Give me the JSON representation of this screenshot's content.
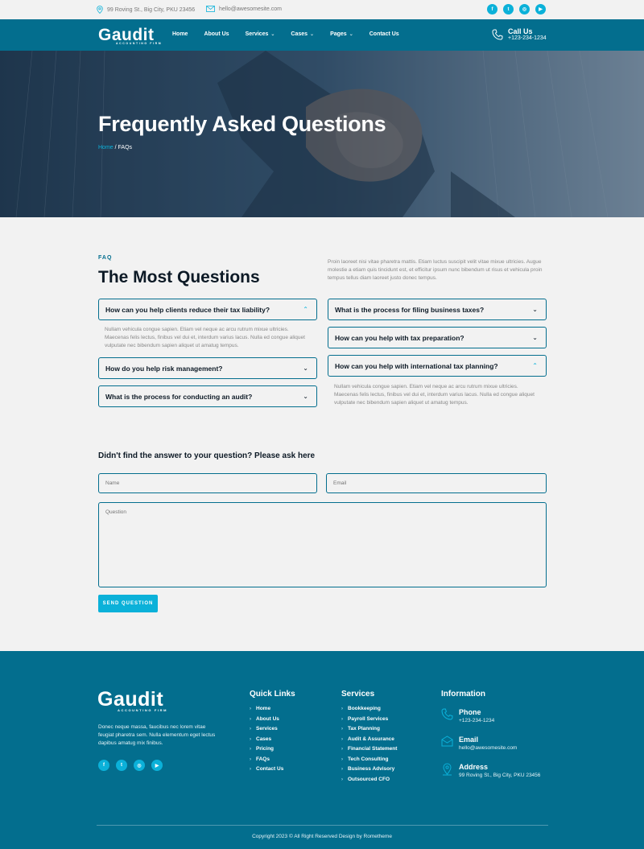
{
  "topbar": {
    "address": "99 Roving St., Big City, PKU 23456",
    "email": "hello@awesomesite.com",
    "socials": [
      "facebook-icon",
      "twitter-icon",
      "instagram-icon",
      "youtube-icon"
    ]
  },
  "brand": {
    "name": "Gaudit",
    "tagline": "Accounting Firm"
  },
  "nav": {
    "items": [
      {
        "label": "Home",
        "dropdown": false
      },
      {
        "label": "About Us",
        "dropdown": false
      },
      {
        "label": "Services",
        "dropdown": true
      },
      {
        "label": "Cases",
        "dropdown": true
      },
      {
        "label": "Pages",
        "dropdown": true
      },
      {
        "label": "Contact Us",
        "dropdown": false
      }
    ],
    "call_title": "Call Us",
    "call_number": "+123-234-1234"
  },
  "hero": {
    "title": "Frequently Asked Questions",
    "breadcrumb_home": "Home",
    "breadcrumb_sep": " / ",
    "breadcrumb_current": "FAQs"
  },
  "faq": {
    "eyebrow": "FAQ",
    "title": "The Most Questions",
    "intro": "Proin laoreet nisi vitae pharetra mattis. Etiam luctus suscipit velit vitae mixue ultricies. Augue molestie a etiam quis tincidunt est, et efficitur ipsum nunc bibendum ut risus et vehicula proin tempus tellus diam laoreet justo donec tempus.",
    "left": [
      {
        "q": "How can you help clients reduce their tax liability?",
        "open": true,
        "a": "Nullam vehicula congue sapien. Etiam vel neque ac arcu rutrum mixue ultricies. Maecenas felis lectus, finibus vel dui et, interdum varius lacus. Nulla ed congue aliquet vulputate nec bibendum sapien aliquet ut amatug tempus."
      },
      {
        "q": "How do you help risk management?",
        "open": false
      },
      {
        "q": "What is the process for conducting an audit?",
        "open": false
      }
    ],
    "right": [
      {
        "q": "What is the process for filing business taxes?",
        "open": false
      },
      {
        "q": "How can you help with tax preparation?",
        "open": false
      },
      {
        "q": "How can you help with international tax planning?",
        "open": true,
        "a": "Nullam vehicula congue sapien. Etiam vel neque ac arcu rutrum mixue ultricies. Maecenas felis lectus, finibus vel dui et, interdum varius lacus. Nulla ed congue aliquet vulputate nec bibendum sapien aliquet ut amatug tempus."
      }
    ]
  },
  "form": {
    "title": "Didn't find the answer to your question? Please ask here",
    "name_placeholder": "Name",
    "email_placeholder": "Email",
    "question_placeholder": "Question",
    "send_label": "SEND QUESTION"
  },
  "footer": {
    "description": "Donec neque massa, faucibus nec lorem vitae feugiat pharetra sem. Nulla elementum eget lectus dapibus amatug mix finibus.",
    "quick_links_title": "Quick Links",
    "quick_links": [
      "Home",
      "About Us",
      "Services",
      "Cases",
      "Pricing",
      "FAQs",
      "Contact Us"
    ],
    "services_title": "Services",
    "services": [
      "Bookkeeping",
      "Payroll Services",
      "Tax Planning",
      "Audit & Assurance",
      "Financial Statement",
      "Tech Consulting",
      "Business Advisory",
      "Outsourced CFO"
    ],
    "info_title": "Information",
    "phone_label": "Phone",
    "phone": "+123-234-1234",
    "email_label": "Email",
    "email": "hello@awesomesite.com",
    "address_label": "Address",
    "address": "99 Roving St., Big City, PKU 23456",
    "copyright": "Copyright 2023 © All Right Reserved Design by Rometheme"
  },
  "colors": {
    "primary": "#036e8e",
    "accent": "#0bb1d9",
    "background": "#f2f2f2",
    "heading": "#0d1a26"
  }
}
